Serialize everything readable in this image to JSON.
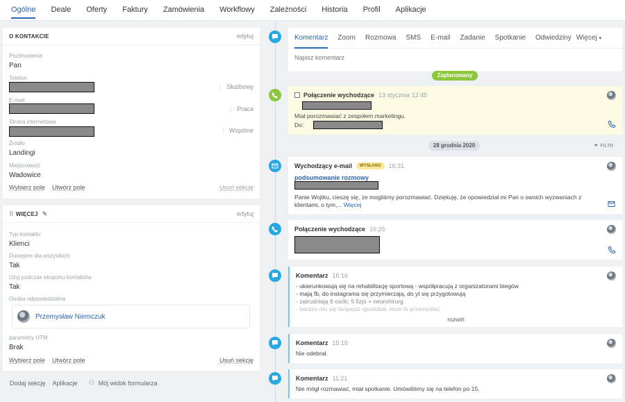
{
  "topnav": {
    "tabs": [
      "Ogólne",
      "Deale",
      "Oferty",
      "Faktury",
      "Zamówienia",
      "Workflowy",
      "Zależności",
      "Historia",
      "Profil",
      "Aplikacje"
    ]
  },
  "contact_card": {
    "title": "O KONTAKCIE",
    "edit": "edytuj",
    "fields": {
      "greeting_label": "Pozdrowienie",
      "greeting_value": "Pan",
      "phone_label": "Telefon",
      "phone_tag": "Służbowy",
      "email_label": "E-mail",
      "email_tag": "Praca",
      "website_label": "Strona internetowa",
      "website_tag": "Wspólne",
      "source_label": "Źródło",
      "source_value": "Landingi",
      "city_label": "Miejscowość",
      "city_value": "Wadowice"
    },
    "links": {
      "choose_field": "Wybierz pole",
      "create_field": "Utwórz pole",
      "remove_section": "Usuń sekcję"
    }
  },
  "more_card": {
    "title": "WIĘCEJ",
    "edit": "edytuj",
    "fields": {
      "type_label": "Typ kontaktu",
      "type_value": "Klienci",
      "available_label": "Dostępne dla wszystkich",
      "available_value": "Tak",
      "export_label": "Użyj podczas eksportu kontaktów",
      "export_value": "Tak",
      "owner_label": "Osoba odpowiedzialna",
      "owner_value": "Przemysław Niemczuk",
      "utm_label": "parametry UTM",
      "utm_value": "Brak"
    },
    "links": {
      "choose_field": "Wybierz pole",
      "create_field": "Utwórz pole",
      "remove_section": "Usuń sekcję"
    }
  },
  "bottom_links": {
    "add_section": "Dodaj sekcję",
    "apps": "Aplikacje",
    "my_form": "Mój widok formularza"
  },
  "comm": {
    "tabs": [
      "Komentarz",
      "Zoom",
      "Rozmowa",
      "SMS",
      "E-mail",
      "Zadanie",
      "Spotkanie",
      "Odwiedziny"
    ],
    "more": "Więcej",
    "placeholder": "Napisz komentarz"
  },
  "timeline": {
    "planned_pill": "Zaplanowany",
    "date_pill": "28 grudnia 2020",
    "filter": "FILTR",
    "call_planned": {
      "title": "Połączenie wychodzące",
      "time": "13 stycznia 12:45",
      "text": "Miał porozmawiać z zespołem marketingu.",
      "to_label": "Do:"
    },
    "email": {
      "title": "Wychodzący e-mail",
      "badge": "WYSŁANO",
      "time": "16:31",
      "subject": "podsumowanie rozmowy",
      "text": "Panie Wojtku, cieszę się, że mogliśmy porozmawiać. Dziękuję, że opowiedział mi Pan o swoich wyzwaniach z klientami, o tym,...",
      "more": "Więcej"
    },
    "call": {
      "title": "Połączenie wychodzące",
      "time": "16:25"
    },
    "comment1": {
      "title": "Komentarz",
      "time": "16:16",
      "lines": [
        "- ukierunkowują się na rehabilitację sportową - współpracują z organizatorami biegów",
        "- mają fb, do instagrama się przymierzają, do yt się przygotowują",
        "- zatrudniają 6 osób: 5 fizjo + neurohirurg",
        "- bardzo mu się fanpejdż spodobał, musi to przemyśleć"
      ],
      "expand": "rozwiń"
    },
    "comment2": {
      "title": "Komentarz",
      "time": "15:16",
      "text": "Nie odebrał."
    },
    "comment3": {
      "title": "Komentarz",
      "time": "11:21",
      "text": "Nie mógł rozmawiać, miał spotkanie. Umówiliśmy się na telefon po 15."
    }
  }
}
